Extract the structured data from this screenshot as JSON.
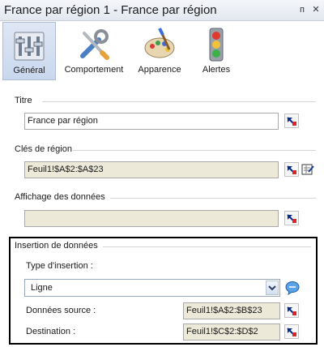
{
  "window": {
    "title": "France par région 1 - France par région",
    "pin_glyph": "ᴨ",
    "close_glyph": "✕"
  },
  "tabs": [
    {
      "label": "Général",
      "icon": "sliders-icon",
      "active": true
    },
    {
      "label": "Comportement",
      "icon": "tools-icon",
      "active": false
    },
    {
      "label": "Apparence",
      "icon": "palette-icon",
      "active": false
    },
    {
      "label": "Alertes",
      "icon": "traffic-light-icon",
      "active": false
    }
  ],
  "titre": {
    "label": "Titre",
    "value": "France par région"
  },
  "cles": {
    "label": "Clés de région",
    "value": "Feuil1!$A$2:$A$23"
  },
  "affichage": {
    "label": "Affichage des données",
    "value": ""
  },
  "insertion": {
    "label": "Insertion de données",
    "type_label": "Type d'insertion :",
    "type_value": "Ligne",
    "source_label": "Données source :",
    "source_value": "Feuil1!$A$2:$B$23",
    "dest_label": "Destination :",
    "dest_value": "Feuil1!$C$2:$D$2"
  },
  "colors": {
    "accent": "#c9d7ee",
    "readonly_bg": "#ece9d8",
    "highlight_border": "#000000"
  }
}
